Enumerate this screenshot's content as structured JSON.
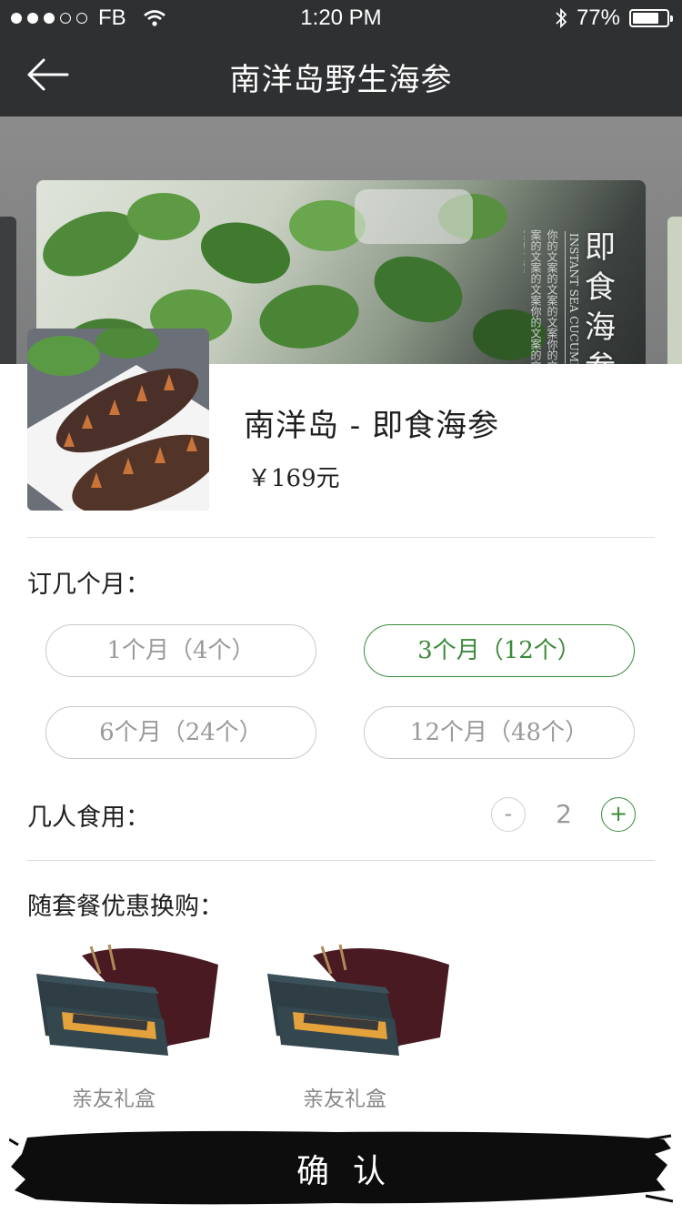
{
  "status_bar": {
    "carrier": "FB",
    "time": "1:20 PM",
    "battery": "77%",
    "battery_level": 0.77
  },
  "nav": {
    "title": "南洋岛野生海参"
  },
  "banner": {
    "title_cn": "即食海参",
    "title_en": "INSTANT SEA CUCUMBER",
    "copy": "你的文案的文案的文案你的文案的文案的文案你的文案的文案的文案"
  },
  "product": {
    "name": "南洋岛 - 即食海参",
    "price": "￥169元"
  },
  "duration": {
    "label": "订几个月：",
    "options": [
      {
        "label": "1个月（4个）",
        "selected": false
      },
      {
        "label": "3个月（12个）",
        "selected": true
      },
      {
        "label": "6个月（24个）",
        "selected": false
      },
      {
        "label": "12个月（48个）",
        "selected": false
      }
    ]
  },
  "people": {
    "label": "几人食用：",
    "minus": "-",
    "value": "2",
    "plus": "+"
  },
  "addons": {
    "label": "随套餐优惠换购：",
    "items": [
      {
        "label": "亲友礼盒"
      },
      {
        "label": "亲友礼盒"
      }
    ]
  },
  "confirm": {
    "label": "确认"
  },
  "colors": {
    "accent": "#3a8a3a",
    "nav_bg": "#2f3032"
  }
}
